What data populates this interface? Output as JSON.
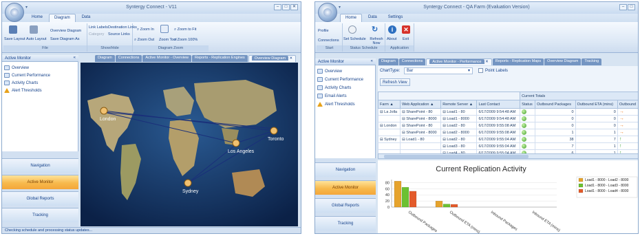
{
  "window1": {
    "title": "Syntergy Connect - V11",
    "tabs": [
      "Home",
      "Diagram",
      "Data"
    ],
    "active_tab": "Diagram",
    "ribbon": {
      "save_layout": "Save Layout",
      "auto_layout": "Auto Layout",
      "overview_diagram": "Overview Diagram",
      "save_diagram_as": "Save Diagram As",
      "file_group": "File",
      "link_labels": "Link Labels",
      "destination_links": "Destination Links",
      "category": "Category",
      "source_links": "Source Links",
      "showhide_group": "Show/Hide",
      "zoom_in": "Zoom In",
      "zoom_out": "Zoom Out",
      "zoom_tool": "Zoom Tool",
      "zoom_to_fit": "Zoom to Fit",
      "zoom_100": "Zoom 100%",
      "zoom_group": "Diagram Zoom"
    },
    "nav_header": "Active Monitor",
    "nav_collapse": "«",
    "nav_items": [
      "Overview",
      "Current Performance",
      "Activity Charts",
      "Alert Thresholds"
    ],
    "bottom_buttons": [
      "Navigation",
      "Active Monitor",
      "Global Reports",
      "Tracking"
    ],
    "doc_tabs": [
      "Diagram",
      "Connections",
      "Active Monitor - Overview",
      "Reports - Replication Engines",
      "Overview Diagram"
    ],
    "active_doc_tab": "Overview Diagram",
    "map_cities": [
      "London",
      "Toronto",
      "Los Angeles",
      "Sydney"
    ],
    "status": "Checking schedule and processing status updates..."
  },
  "window2": {
    "title": "Syntergy Connect - QA Farm (Evaluation Version)",
    "tabs": [
      "Home",
      "Data",
      "Settings"
    ],
    "active_tab": "Home",
    "ribbon": {
      "profile": "Profile",
      "connections": "Connections",
      "set_schedule": "Set Schedule",
      "refresh_now": "Refresh Now",
      "about": "About",
      "exit": "Exit",
      "start_group": "Start",
      "status_schedule_group": "Status Schedule",
      "application_group": "Application"
    },
    "nav_header": "Active Monitor",
    "nav_collapse": "«",
    "nav_items": [
      "Overview",
      "Current Performance",
      "Activity Charts",
      "Email Alerts",
      "Alert Thresholds"
    ],
    "bottom_buttons": [
      "Navigation",
      "Active Monitor",
      "Global Reports",
      "Tracking"
    ],
    "doc_tabs": [
      "Diagram",
      "Connections",
      "Active Monitor - Performance",
      "Reports - Replication Maps",
      "Overview Diagram",
      "Tracking"
    ],
    "active_doc_tab": "Active Monitor - Performance",
    "chart_type_label": "ChartType:",
    "chart_type_value": "Bar",
    "point_labels": "Point Labels",
    "refresh_view": "Refresh View",
    "table": {
      "group_header": "Current Totals",
      "columns": [
        "Farm",
        "Web Application",
        "Remote Server",
        "Last Contact",
        "Status",
        "Outbound Packages",
        "Outbound ETA (mins)",
        "Outbound"
      ],
      "rows": [
        {
          "farm": "La Jolla",
          "web": "SharePoint - 80",
          "remote": "Load1 - 80",
          "contact": "6/17/2009 9:54:48 AM",
          "packages": "0",
          "eta": "0",
          "trend": "right"
        },
        {
          "farm": "",
          "web": "SharePoint - 8000",
          "remote": "Load1 - 8000",
          "contact": "6/17/2009 9:54:48 AM",
          "packages": "0",
          "eta": "0",
          "trend": "right"
        },
        {
          "farm": "London",
          "web": "SharePoint - 80",
          "remote": "Load2 - 80",
          "contact": "6/17/2009 9:55:08 AM",
          "packages": "0",
          "eta": "0",
          "trend": "right"
        },
        {
          "farm": "",
          "web": "SharePoint - 8000",
          "remote": "Load2 - 8000",
          "contact": "6/17/2009 9:55:08 AM",
          "packages": "1",
          "eta": "1",
          "trend": "right"
        },
        {
          "farm": "Sydney",
          "web": "Load1 - 80",
          "remote": "Load2 - 80",
          "contact": "6/17/2009 9:55:04 AM",
          "packages": "38",
          "eta": "7",
          "trend": "up"
        },
        {
          "farm": "",
          "web": "",
          "remote": "Load3 - 80",
          "contact": "6/17/2009 9:55:04 AM",
          "packages": "7",
          "eta": "1",
          "trend": "up"
        },
        {
          "farm": "",
          "web": "",
          "remote": "Load4 - 80",
          "contact": "6/17/2009 9:55:04 AM",
          "packages": "6",
          "eta": "1",
          "trend": "up"
        }
      ]
    },
    "trend_colors": {
      "right": "#ee7b1c",
      "up": "#2f9a2a"
    }
  },
  "chart_data": {
    "type": "bar",
    "title": "Current Replication Activity",
    "categories": [
      "Outbound Packages",
      "Outbound ETA (mins)",
      "Inbound Packages",
      "Inbound ETA (mins)"
    ],
    "series": [
      {
        "name": "Load1 - 8000 - Load2 - 8000",
        "color": "#e6a32c",
        "values": [
          85,
          20,
          0,
          0
        ]
      },
      {
        "name": "Load1 - 8000 - Load3 - 8000",
        "color": "#6cc131",
        "values": [
          65,
          10,
          0,
          0
        ]
      },
      {
        "name": "Load1 - 8000 - Load4 - 8000",
        "color": "#e35b2b",
        "values": [
          52,
          9,
          0,
          0
        ]
      }
    ],
    "yticks": [
      "80",
      "60",
      "40",
      "20",
      "0"
    ],
    "ylim": [
      0,
      90
    ],
    "legend": "right"
  }
}
